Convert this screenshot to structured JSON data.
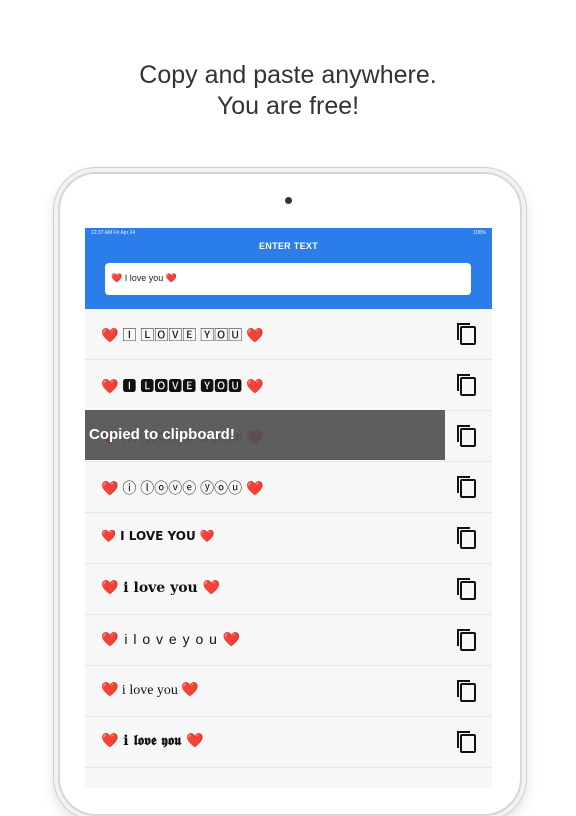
{
  "promo": {
    "line1": "Copy and paste anywhere.",
    "line2": "You are free!"
  },
  "status_bar": {
    "left": "12:37 AM  Fri Apr 24",
    "right": "100%"
  },
  "header": {
    "title": "ENTER TEXT",
    "input_value": "❤️ I love you ❤️"
  },
  "toast": {
    "text": "Copied to clipboard!"
  },
  "rows": [
    {
      "style": "boxed",
      "text": "❤️ 🄸 🄻🄾🅅🄴 🅈🄾🅄 ❤️"
    },
    {
      "style": "boxed-dark",
      "text": "❤️ 🅸 🅻🅾🆅🅴 🆈🅾🆄 ❤️"
    },
    {
      "style": "parenthesized",
      "text": "❤️ ⒤ ⒧⒪⒱⒠ ⒴⒪⒰ ❤️"
    },
    {
      "style": "circled",
      "text": "❤️ ⓘ ⓛⓞⓥⓔ ⓨⓞⓤ ❤️"
    },
    {
      "style": "bold-caps",
      "text": "❤️ I LOVE YOU ❤️"
    },
    {
      "style": "outline",
      "text": "❤️ i love you ❤️"
    },
    {
      "style": "spaced",
      "text": "❤️ i l o v e y o u ❤️"
    },
    {
      "style": "serif",
      "text": "❤️ i love you ❤️"
    },
    {
      "style": "gothic",
      "text": "❤️ i 𝖑𝖔𝖛𝖊 𝖞𝖔𝖚 ❤️"
    }
  ],
  "icons": {
    "copy": "copy-icon",
    "camera": "camera-icon"
  },
  "colors": {
    "header": "#2b7de9",
    "heart": "#e8192c"
  }
}
